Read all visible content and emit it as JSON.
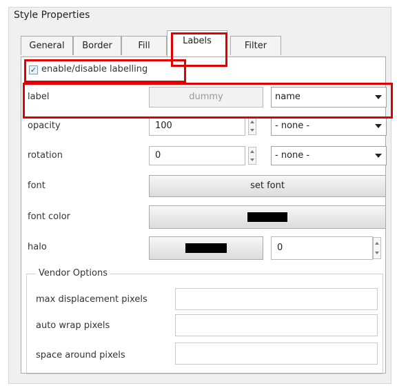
{
  "panel": {
    "title": "Style Properties"
  },
  "tabs": [
    {
      "label": "General"
    },
    {
      "label": "Border"
    },
    {
      "label": "Fill"
    },
    {
      "label": "Labels"
    },
    {
      "label": "Filter"
    }
  ],
  "active_tab": "Labels",
  "labelling": {
    "checkbox_label": "enable/disable labelling",
    "checked": true
  },
  "rows": {
    "label": {
      "label": "label",
      "value": "dummy",
      "select": "name"
    },
    "opacity": {
      "label": "opacity",
      "value": "100",
      "select": "- none -"
    },
    "rotation": {
      "label": "rotation",
      "value": "0",
      "select": "- none -"
    },
    "font": {
      "label": "font",
      "button": "set font"
    },
    "font_color": {
      "label": "font color",
      "color": "#000000"
    },
    "halo": {
      "label": "halo",
      "color": "#000000",
      "value": "0"
    }
  },
  "vendor_options": {
    "title": "Vendor Options",
    "items": [
      {
        "label": "max displacement pixels",
        "value": ""
      },
      {
        "label": "auto wrap pixels",
        "value": ""
      },
      {
        "label": "space around pixels",
        "value": ""
      }
    ]
  },
  "highlight_color": "#e00000"
}
